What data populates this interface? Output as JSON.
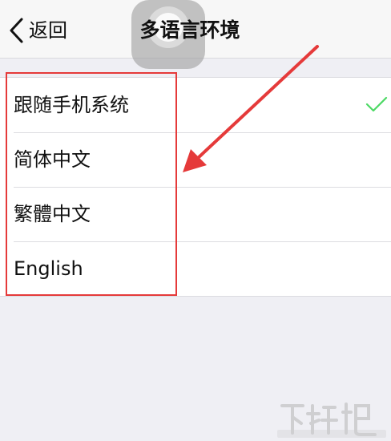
{
  "nav": {
    "back_label": "返回",
    "title": "多语言环境"
  },
  "languages": [
    {
      "label": "跟随手机系统",
      "selected": true
    },
    {
      "label": "简体中文",
      "selected": false
    },
    {
      "label": "繁體中文",
      "selected": false
    },
    {
      "label": "English",
      "selected": false
    }
  ],
  "icons": {
    "back": "chevron-left-icon",
    "selected": "checkmark-icon"
  },
  "colors": {
    "check": "#4cd964",
    "annotation": "#e53a3a",
    "background": "#efeff4"
  }
}
